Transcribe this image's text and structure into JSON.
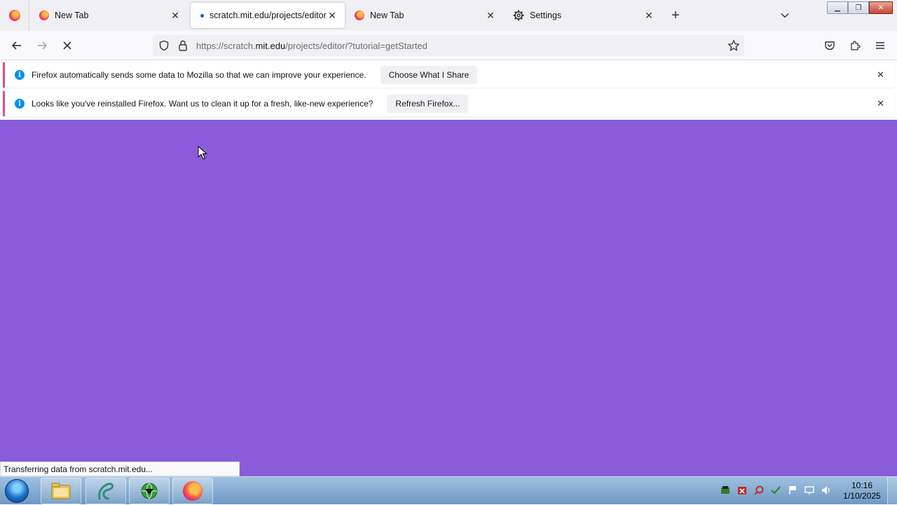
{
  "tabs": [
    {
      "title": "New Tab",
      "active": false
    },
    {
      "title": "scratch.mit.edu/projects/editor/?tutorial=getStarted",
      "active": true
    },
    {
      "title": "New Tab",
      "active": false
    },
    {
      "title": "Settings",
      "active": false
    }
  ],
  "toolbar": {
    "url_prefix": "https://scratch.",
    "url_host": "mit.edu",
    "url_path": "/projects/editor/?tutorial=getStarted"
  },
  "notifications": [
    {
      "message": "Firefox automatically sends some data to Mozilla so that we can improve your experience.",
      "action": "Choose What I Share"
    },
    {
      "message": "Looks like you've reinstalled Firefox. Want us to clean it up for a fresh, like-new experience?",
      "action": "Refresh Firefox..."
    }
  ],
  "status_bar": "Transferring data from scratch.mit.edu...",
  "clock": {
    "time": "10:16",
    "date": "1/10/2025"
  },
  "colors": {
    "page_background": "#8a5cd9",
    "notification_accent": "#d7508c",
    "info_icon": "#0090ed"
  },
  "icons": [
    "firefox-icon",
    "close-icon",
    "gear-icon",
    "plus-icon",
    "chevron-down-icon",
    "back-arrow-icon",
    "forward-arrow-icon",
    "stop-icon",
    "shield-icon",
    "lock-icon",
    "star-icon",
    "pocket-icon",
    "extensions-icon",
    "menu-icon",
    "info-icon"
  ]
}
